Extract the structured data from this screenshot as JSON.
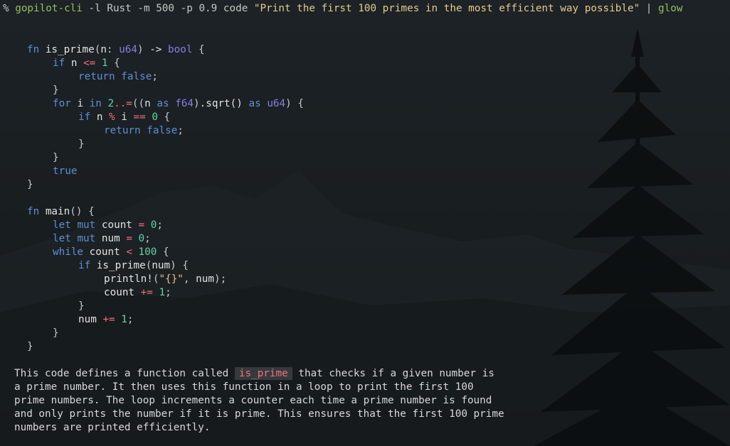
{
  "terminal": {
    "prompt_symbol": "%",
    "command": "gopilot-cli",
    "args": " -l Rust -m 500 -p 0.9 code ",
    "query": "\"Print the first 100 primes in the most efficient way possible\"",
    "pipe": " | ",
    "pipe_target": "glow"
  },
  "code": {
    "fn1_kw": "fn",
    "fn1_name": "is_prime",
    "fn1_param": "n",
    "fn1_param_type": "u64",
    "fn1_arrow": "->",
    "fn1_ret": "bool",
    "if_kw": "if",
    "if_var": "n",
    "if_op": "<=",
    "if_num": "1",
    "return_kw": "return",
    "false_kw": "false",
    "for_kw": "for",
    "for_var": "i",
    "in_kw": "in",
    "range_start": "2",
    "range_op": "..=",
    "as_kw": "as",
    "f64_type": "f64",
    "sqrt_call": ".sqrt()",
    "u64_type": "u64",
    "if2_expr_n": "n",
    "mod_op": "%",
    "if2_i": "i",
    "eq_op": "==",
    "zero": "0",
    "true_kw": "true",
    "fn2_name": "main",
    "let_kw": "let",
    "mut_kw": "mut",
    "count_var": "count",
    "assign_op": "=",
    "num_var": "num",
    "while_kw": "while",
    "lt_op": "<",
    "limit": "100",
    "call_is_prime": "is_prime",
    "println_macro": "println!",
    "fmt_str": "\"{}\"",
    "plus_eq_op": "+=",
    "one": "1"
  },
  "explanation": {
    "line1_before": "This code defines a function called ",
    "inline_code": "is_prime",
    "line1_after": " that checks if a given number is",
    "line2": "a prime number. It then uses this function in a loop to print the first 100",
    "line3": "prime numbers. The loop increments a counter each time a prime number is found",
    "line4": "and only prints the number if it is prime. This ensures that the first 100 prime",
    "line5": "numbers are printed efficiently."
  }
}
